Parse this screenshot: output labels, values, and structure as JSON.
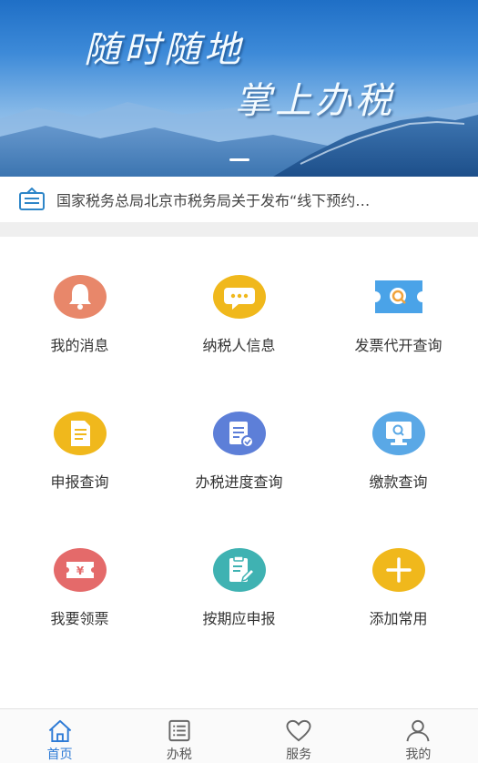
{
  "banner": {
    "line1": "随时随地",
    "line2": "掌上办税"
  },
  "notice": {
    "text": "国家税务总局北京市税务局关于发布“线下预约…"
  },
  "grid": {
    "items": [
      {
        "label": "我的消息",
        "icon": "bell-icon",
        "color": "#e8876a"
      },
      {
        "label": "纳税人信息",
        "icon": "chat-bubble-icon",
        "color": "#f0b81c"
      },
      {
        "label": "发票代开查询",
        "icon": "invoice-search-icon",
        "color": "#4aa3e8"
      },
      {
        "label": "申报查询",
        "icon": "document-icon",
        "color": "#f0b81c"
      },
      {
        "label": "办税进度查询",
        "icon": "progress-document-icon",
        "color": "#5d7fd8"
      },
      {
        "label": "缴款查询",
        "icon": "monitor-search-icon",
        "color": "#5aa8e6"
      },
      {
        "label": "我要领票",
        "icon": "ticket-icon",
        "color": "#e46a6a"
      },
      {
        "label": "按期应申报",
        "icon": "clipboard-edit-icon",
        "color": "#3fb2b2"
      },
      {
        "label": "添加常用",
        "icon": "plus-icon",
        "color": "#f0b81c"
      }
    ]
  },
  "nav": {
    "items": [
      {
        "label": "首页",
        "icon": "home-icon",
        "active": true
      },
      {
        "label": "办税",
        "icon": "list-icon",
        "active": false
      },
      {
        "label": "服务",
        "icon": "heart-icon",
        "active": false
      },
      {
        "label": "我的",
        "icon": "user-icon",
        "active": false
      }
    ],
    "active_color": "#2e7bd6"
  }
}
